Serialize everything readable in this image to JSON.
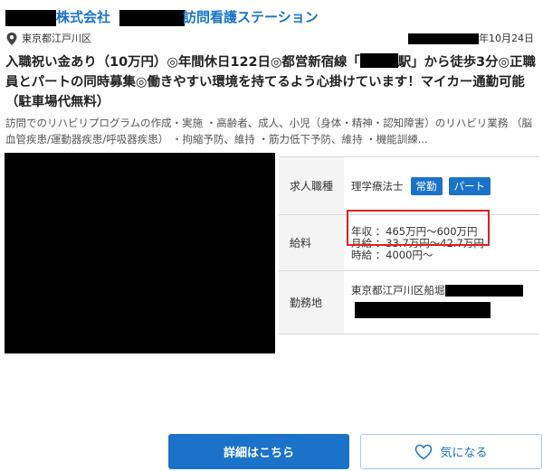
{
  "header": {
    "company_suffix": "株式会社",
    "station_name": "訪問看護ステーション"
  },
  "meta": {
    "location": "東京都江戸川区",
    "date_suffix": "年10月24日"
  },
  "headline": {
    "part1": "入職祝い金あり（10万円）◎年間休日122日◎都営新宿線「",
    "part2": "駅」から徒歩3分◎正職員とパートの同時募集◎働きやすい環境を持てるよう心掛けています！マイカー通勤可能（駐車場代無料）"
  },
  "description": "訪問でのリハビリプログラムの作成・実施 ・高齢者、成人、小児（身体・精神・認知障害）のリハビリ業務 （脳血管疾患/運動器疾患/呼吸器疾患） ・拘縮予防、維持 ・筋力低下予防、維持 ・機能訓練...",
  "details": {
    "job_label": "求人職種",
    "job_value": "理学療法士",
    "tags": [
      "常勤",
      "パート"
    ],
    "salary_label": "給料",
    "salary_annual": "年収 ：465万円～600万円",
    "salary_monthly": "月給 ：33.7万円～42.7万円",
    "salary_hourly": "時給 ：4000円～",
    "workplace_label": "勤務地",
    "workplace_value": "東京都江戸川区船堀"
  },
  "buttons": {
    "detail": "詳細はこちら",
    "favorite": "気になる"
  },
  "colors": {
    "accent": "#1a73c8",
    "highlight": "#e02020"
  }
}
